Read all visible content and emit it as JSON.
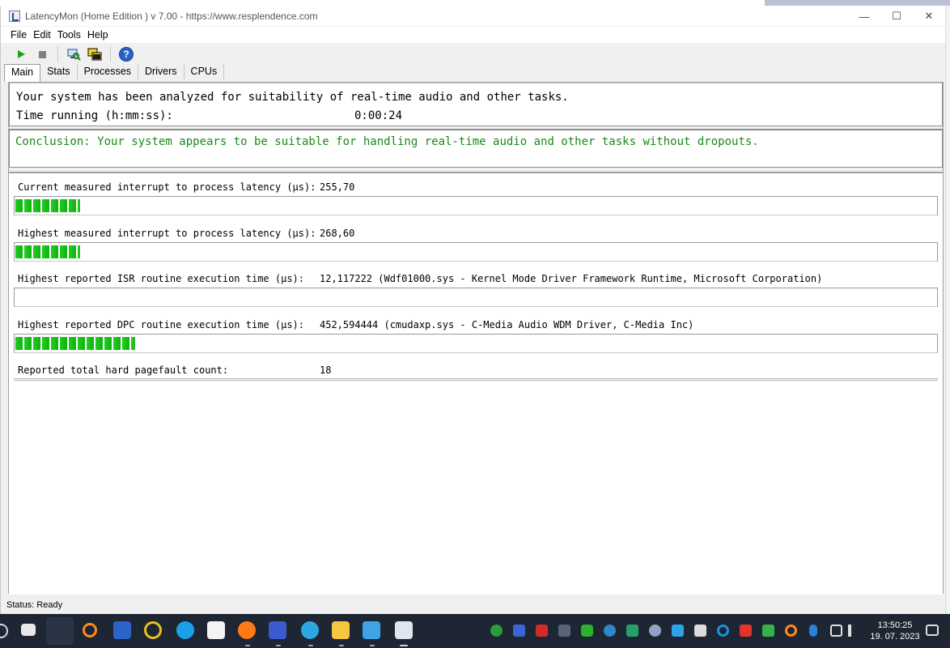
{
  "window": {
    "title": "LatencyMon  (Home Edition )  v 7.00 - https://www.resplendence.com",
    "min_glyph": "—",
    "max_glyph": "☐",
    "close_glyph": "✕"
  },
  "menu": [
    "File",
    "Edit",
    "Tools",
    "Help"
  ],
  "toolbar": {
    "play_icon": "play-icon",
    "stop_icon": "stop-icon",
    "help_label": "?"
  },
  "tabs": [
    "Main",
    "Stats",
    "Processes",
    "Drivers",
    "CPUs"
  ],
  "main": {
    "summary": "Your system has been analyzed for suitability of real-time audio and other tasks.",
    "time_label": "Time running (h:mm:ss):",
    "time_value": "0:00:24",
    "conclusion": "Conclusion: Your system appears to be suitable for handling real-time audio and other tasks without dropouts.",
    "conclusion_color": "#1a8a1a",
    "metrics": [
      {
        "label": "Current measured interrupt to process latency (µs):",
        "value": "255,70",
        "bar_fraction": 0.07
      },
      {
        "label": "Highest measured interrupt to process latency (µs):",
        "value": "268,60",
        "bar_fraction": 0.07
      },
      {
        "label": "Highest reported ISR routine execution time (µs):",
        "value": "12,117222  (Wdf01000.sys - Kernel Mode Driver Framework Runtime, Microsoft Corporation)",
        "bar_fraction": 0.0
      },
      {
        "label": "Highest reported DPC routine execution time (µs):",
        "value": "452,594444  (cmudaxp.sys - C-Media Audio WDM Driver, C-Media Inc)",
        "bar_fraction": 0.13
      },
      {
        "label": "Reported total hard pagefault count:",
        "value": "18"
      }
    ]
  },
  "status": "Status: Ready",
  "taskbar": {
    "time": "13:50:25",
    "date": "19. 07. 2023"
  },
  "colors": {
    "bar_green": "#1fcf1f",
    "taskbar_bg": "#1e2633"
  }
}
